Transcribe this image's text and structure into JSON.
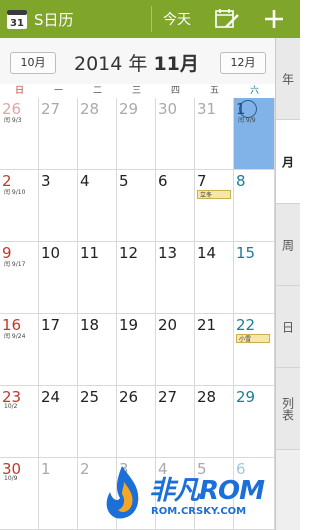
{
  "app": {
    "title": "S日历",
    "icon_day": "31",
    "today_label": "今天"
  },
  "nav": {
    "prev_month": "10月",
    "next_month": "12月",
    "year_text": "2014 年 ",
    "month_text": "11月"
  },
  "weekdays": [
    "日",
    "一",
    "二",
    "三",
    "四",
    "五",
    "六"
  ],
  "calendar": {
    "weeks": [
      [
        {
          "d": "26",
          "lunar": "闰 9/3",
          "other": true
        },
        {
          "d": "27",
          "other": true
        },
        {
          "d": "28",
          "other": true
        },
        {
          "d": "29",
          "other": true
        },
        {
          "d": "30",
          "other": true
        },
        {
          "d": "31",
          "other": true
        },
        {
          "d": "1",
          "lunar": "闰 9/9",
          "selected": true,
          "today": true
        }
      ],
      [
        {
          "d": "2",
          "lunar": "闰 9/10"
        },
        {
          "d": "3"
        },
        {
          "d": "4"
        },
        {
          "d": "5"
        },
        {
          "d": "6"
        },
        {
          "d": "7",
          "term": "立冬"
        },
        {
          "d": "8"
        }
      ],
      [
        {
          "d": "9",
          "lunar": "闰 9/17"
        },
        {
          "d": "10"
        },
        {
          "d": "11"
        },
        {
          "d": "12"
        },
        {
          "d": "13"
        },
        {
          "d": "14"
        },
        {
          "d": "15"
        }
      ],
      [
        {
          "d": "16",
          "lunar": "闰 9/24"
        },
        {
          "d": "17"
        },
        {
          "d": "18"
        },
        {
          "d": "19"
        },
        {
          "d": "20"
        },
        {
          "d": "21"
        },
        {
          "d": "22",
          "term": "小雪"
        }
      ],
      [
        {
          "d": "23",
          "lunar": "10/2"
        },
        {
          "d": "24"
        },
        {
          "d": "25"
        },
        {
          "d": "26"
        },
        {
          "d": "27"
        },
        {
          "d": "28"
        },
        {
          "d": "29"
        }
      ],
      [
        {
          "d": "30",
          "lunar": "10/9"
        },
        {
          "d": "1",
          "other": true
        },
        {
          "d": "2",
          "other": true
        },
        {
          "d": "3",
          "other": true
        },
        {
          "d": "4",
          "other": true
        },
        {
          "d": "5",
          "other": true
        },
        {
          "d": "6",
          "other": true
        }
      ]
    ]
  },
  "view_tabs": [
    "年",
    "月",
    "周",
    "日",
    "列表"
  ],
  "active_tab": "月",
  "watermark": {
    "brand": "非凡ROM",
    "url": "ROM.CRSKY.COM"
  },
  "colors": {
    "appbar": "#7fa52a",
    "sunday": "#c0392b",
    "saturday": "#1a7d99",
    "selected": "#82b3e8",
    "term_bg": "#f7e6a6"
  }
}
